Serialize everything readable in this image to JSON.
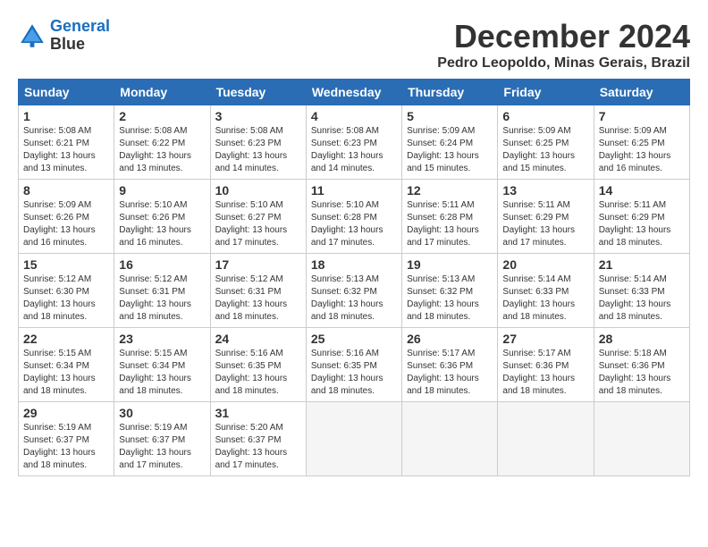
{
  "logo": {
    "line1": "General",
    "line2": "Blue"
  },
  "title": "December 2024",
  "location": "Pedro Leopoldo, Minas Gerais, Brazil",
  "days_of_week": [
    "Sunday",
    "Monday",
    "Tuesday",
    "Wednesday",
    "Thursday",
    "Friday",
    "Saturday"
  ],
  "weeks": [
    [
      {
        "day": "1",
        "rise": "5:08 AM",
        "set": "6:21 PM",
        "daylight": "13 hours and 13 minutes."
      },
      {
        "day": "2",
        "rise": "5:08 AM",
        "set": "6:22 PM",
        "daylight": "13 hours and 13 minutes."
      },
      {
        "day": "3",
        "rise": "5:08 AM",
        "set": "6:23 PM",
        "daylight": "13 hours and 14 minutes."
      },
      {
        "day": "4",
        "rise": "5:08 AM",
        "set": "6:23 PM",
        "daylight": "13 hours and 14 minutes."
      },
      {
        "day": "5",
        "rise": "5:09 AM",
        "set": "6:24 PM",
        "daylight": "13 hours and 15 minutes."
      },
      {
        "day": "6",
        "rise": "5:09 AM",
        "set": "6:25 PM",
        "daylight": "13 hours and 15 minutes."
      },
      {
        "day": "7",
        "rise": "5:09 AM",
        "set": "6:25 PM",
        "daylight": "13 hours and 16 minutes."
      }
    ],
    [
      {
        "day": "8",
        "rise": "5:09 AM",
        "set": "6:26 PM",
        "daylight": "13 hours and 16 minutes."
      },
      {
        "day": "9",
        "rise": "5:10 AM",
        "set": "6:26 PM",
        "daylight": "13 hours and 16 minutes."
      },
      {
        "day": "10",
        "rise": "5:10 AM",
        "set": "6:27 PM",
        "daylight": "13 hours and 17 minutes."
      },
      {
        "day": "11",
        "rise": "5:10 AM",
        "set": "6:28 PM",
        "daylight": "13 hours and 17 minutes."
      },
      {
        "day": "12",
        "rise": "5:11 AM",
        "set": "6:28 PM",
        "daylight": "13 hours and 17 minutes."
      },
      {
        "day": "13",
        "rise": "5:11 AM",
        "set": "6:29 PM",
        "daylight": "13 hours and 17 minutes."
      },
      {
        "day": "14",
        "rise": "5:11 AM",
        "set": "6:29 PM",
        "daylight": "13 hours and 18 minutes."
      }
    ],
    [
      {
        "day": "15",
        "rise": "5:12 AM",
        "set": "6:30 PM",
        "daylight": "13 hours and 18 minutes."
      },
      {
        "day": "16",
        "rise": "5:12 AM",
        "set": "6:31 PM",
        "daylight": "13 hours and 18 minutes."
      },
      {
        "day": "17",
        "rise": "5:12 AM",
        "set": "6:31 PM",
        "daylight": "13 hours and 18 minutes."
      },
      {
        "day": "18",
        "rise": "5:13 AM",
        "set": "6:32 PM",
        "daylight": "13 hours and 18 minutes."
      },
      {
        "day": "19",
        "rise": "5:13 AM",
        "set": "6:32 PM",
        "daylight": "13 hours and 18 minutes."
      },
      {
        "day": "20",
        "rise": "5:14 AM",
        "set": "6:33 PM",
        "daylight": "13 hours and 18 minutes."
      },
      {
        "day": "21",
        "rise": "5:14 AM",
        "set": "6:33 PM",
        "daylight": "13 hours and 18 minutes."
      }
    ],
    [
      {
        "day": "22",
        "rise": "5:15 AM",
        "set": "6:34 PM",
        "daylight": "13 hours and 18 minutes."
      },
      {
        "day": "23",
        "rise": "5:15 AM",
        "set": "6:34 PM",
        "daylight": "13 hours and 18 minutes."
      },
      {
        "day": "24",
        "rise": "5:16 AM",
        "set": "6:35 PM",
        "daylight": "13 hours and 18 minutes."
      },
      {
        "day": "25",
        "rise": "5:16 AM",
        "set": "6:35 PM",
        "daylight": "13 hours and 18 minutes."
      },
      {
        "day": "26",
        "rise": "5:17 AM",
        "set": "6:36 PM",
        "daylight": "13 hours and 18 minutes."
      },
      {
        "day": "27",
        "rise": "5:17 AM",
        "set": "6:36 PM",
        "daylight": "13 hours and 18 minutes."
      },
      {
        "day": "28",
        "rise": "5:18 AM",
        "set": "6:36 PM",
        "daylight": "13 hours and 18 minutes."
      }
    ],
    [
      {
        "day": "29",
        "rise": "5:19 AM",
        "set": "6:37 PM",
        "daylight": "13 hours and 18 minutes."
      },
      {
        "day": "30",
        "rise": "5:19 AM",
        "set": "6:37 PM",
        "daylight": "13 hours and 17 minutes."
      },
      {
        "day": "31",
        "rise": "5:20 AM",
        "set": "6:37 PM",
        "daylight": "13 hours and 17 minutes."
      },
      null,
      null,
      null,
      null
    ]
  ]
}
